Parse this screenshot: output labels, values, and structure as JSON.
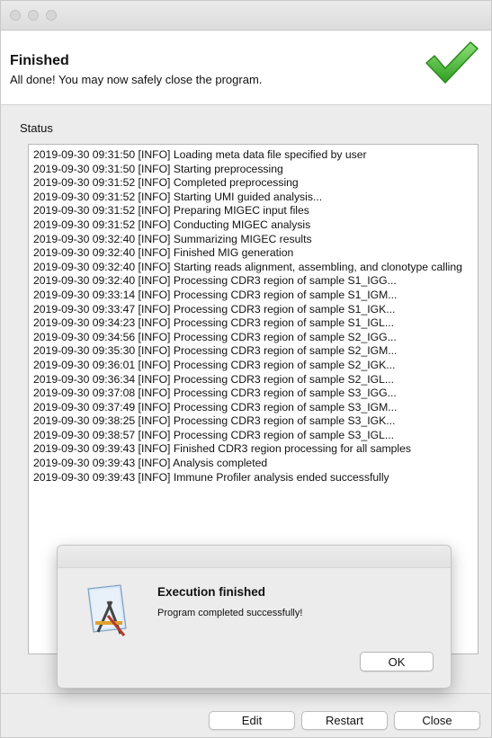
{
  "header": {
    "title": "Finished",
    "subtitle": "All done! You may now safely close the program.",
    "icon": "checkmark-icon",
    "accent_color": "#3fb82a"
  },
  "status": {
    "label": "Status",
    "lines": [
      "2019-09-30 09:31:50 [INFO] Loading meta data file specified by user",
      "2019-09-30 09:31:50 [INFO] Starting preprocessing",
      "2019-09-30 09:31:52 [INFO] Completed preprocessing",
      "2019-09-30 09:31:52 [INFO] Starting UMI guided analysis...",
      "2019-09-30 09:31:52 [INFO] Preparing MIGEC input files",
      "2019-09-30 09:31:52 [INFO] Conducting MIGEC analysis",
      "2019-09-30 09:32:40 [INFO] Summarizing MIGEC results",
      "2019-09-30 09:32:40 [INFO] Finished MIG generation",
      "2019-09-30 09:32:40 [INFO] Starting reads alignment, assembling, and clonotype calling",
      "2019-09-30 09:32:40 [INFO] Processing CDR3 region of sample S1_IGG...",
      "2019-09-30 09:33:14 [INFO] Processing CDR3 region of sample S1_IGM...",
      "2019-09-30 09:33:47 [INFO] Processing CDR3 region of sample S1_IGK...",
      "2019-09-30 09:34:23 [INFO] Processing CDR3 region of sample S1_IGL...",
      "2019-09-30 09:34:56 [INFO] Processing CDR3 region of sample S2_IGG...",
      "2019-09-30 09:35:30 [INFO] Processing CDR3 region of sample S2_IGM...",
      "2019-09-30 09:36:01 [INFO] Processing CDR3 region of sample S2_IGK...",
      "2019-09-30 09:36:34 [INFO] Processing CDR3 region of sample S2_IGL...",
      "2019-09-30 09:37:08 [INFO] Processing CDR3 region of sample S3_IGG...",
      "2019-09-30 09:37:49 [INFO] Processing CDR3 region of sample S3_IGM...",
      "2019-09-30 09:38:25 [INFO] Processing CDR3 region of sample S3_IGK...",
      "2019-09-30 09:38:57 [INFO] Processing CDR3 region of sample S3_IGL...",
      "2019-09-30 09:39:43 [INFO] Finished CDR3 region processing for all samples",
      "2019-09-30 09:39:43 [INFO] Analysis completed",
      "2019-09-30 09:39:43 [INFO] Immune Profiler analysis ended successfully"
    ]
  },
  "dialog": {
    "title": "Execution finished",
    "message": "Program completed successfully!",
    "ok_label": "OK",
    "icon": "app-icon"
  },
  "footer": {
    "edit_label": "Edit",
    "restart_label": "Restart",
    "close_label": "Close"
  }
}
